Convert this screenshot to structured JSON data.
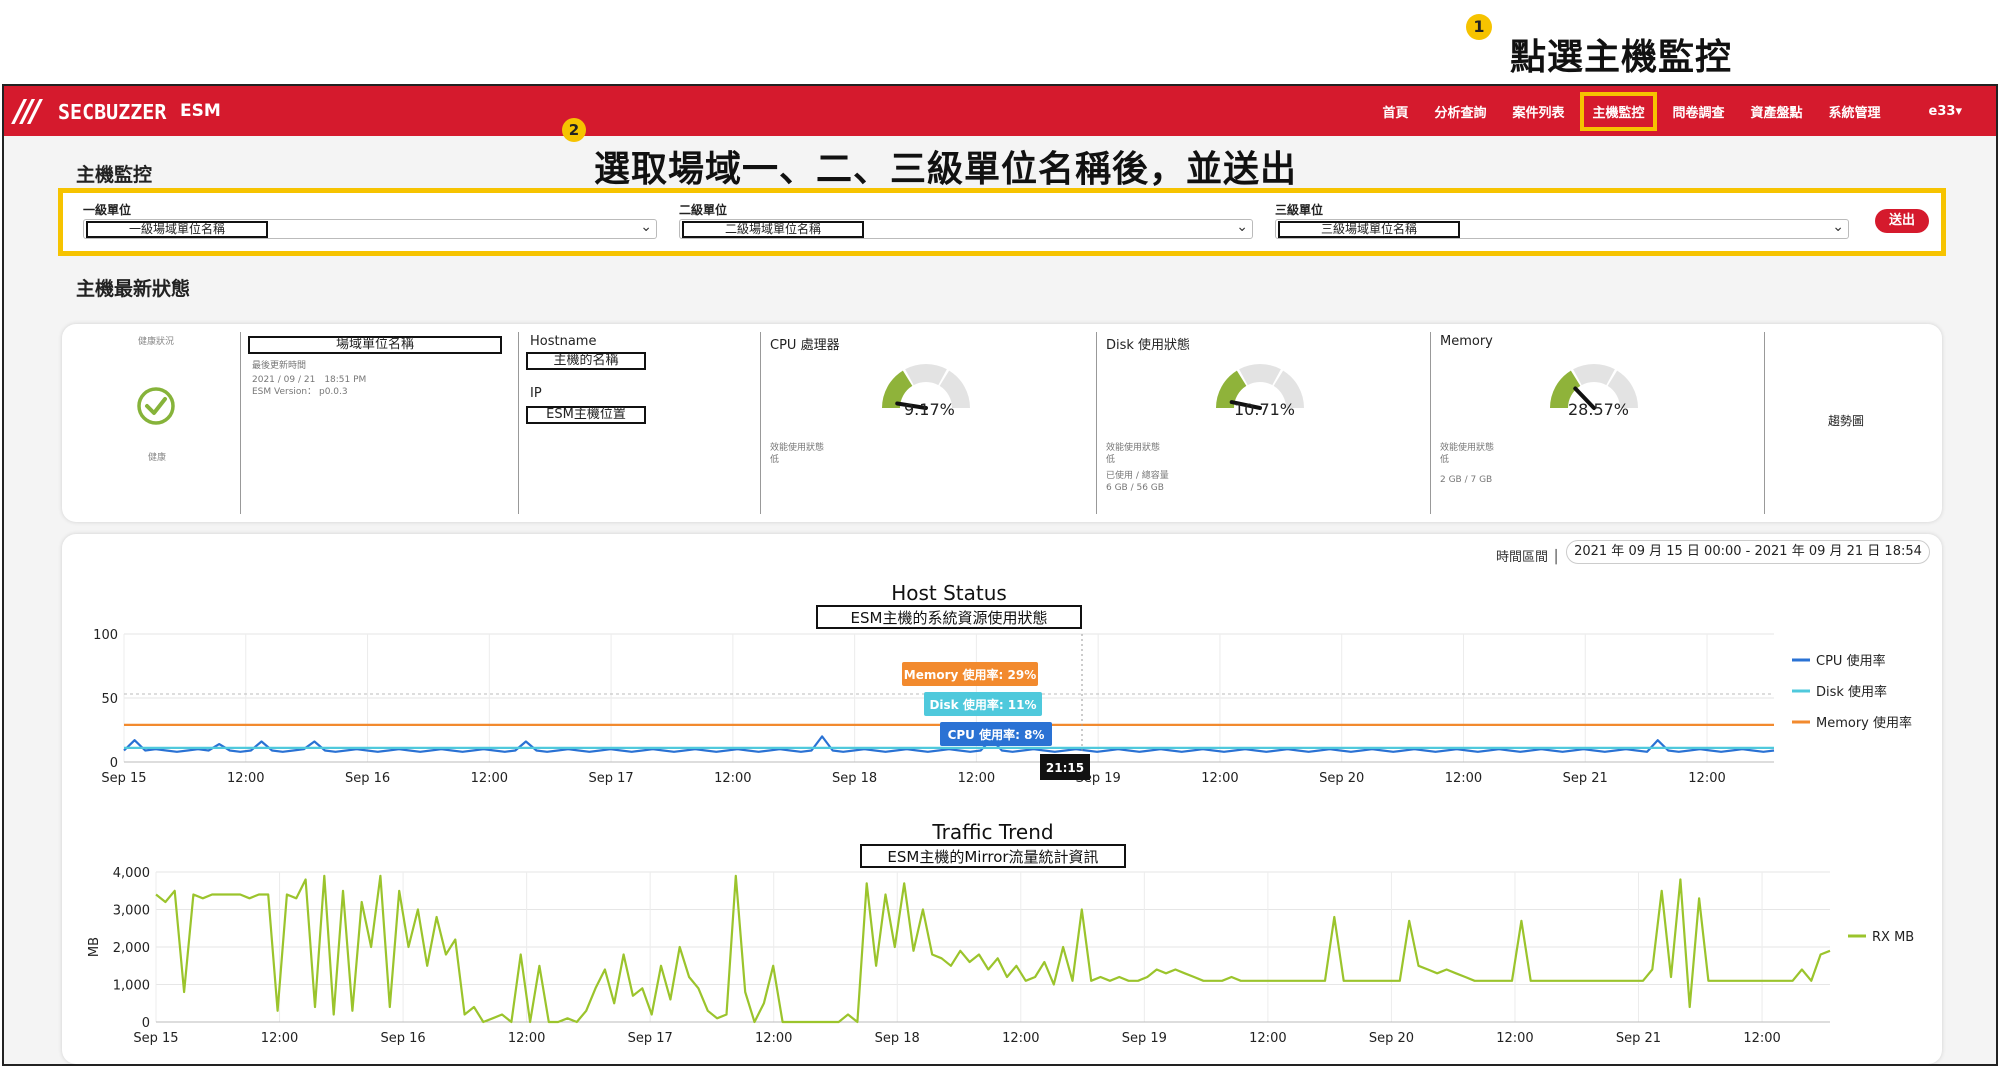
{
  "annotations": {
    "step1_number": "1",
    "step1_text": "點選主機監控",
    "step2_number": "2",
    "step2_text": "選取場域一、二、三級單位名稱後，並送出"
  },
  "topbar": {
    "brand": "SECBUZZER",
    "product": "ESM",
    "nav": [
      "首頁",
      "分析查詢",
      "案件列表",
      "主機監控",
      "問卷調查",
      "資產盤點",
      "系統管理"
    ],
    "active_nav": "主機監控",
    "user": "e33",
    "colors": {
      "bar": "#d51a2d",
      "highlight": "#f6c300"
    }
  },
  "page_title": "主機監控",
  "filters": [
    {
      "label": "一級單位",
      "value": "一級場域單位名稱"
    },
    {
      "label": "二級單位",
      "value": "二級場域單位名稱"
    },
    {
      "label": "三級單位",
      "value": "三級場域單位名稱"
    }
  ],
  "submit_label": "送出",
  "section_title": "主機最新狀態",
  "status": {
    "health_label": "健康狀況",
    "health_value": "健康",
    "unit_name": "場域單位名稱",
    "last_update_label": "最後更新時間",
    "last_update": "2021 / 09 / 21　18:51 PM",
    "version": "ESM Version： p0.0.3",
    "hostname_label": "Hostname",
    "hostname_value": "主機的名稱",
    "ip_label": "IP",
    "ip_value": "ESM主機位置",
    "cpu": {
      "title": "CPU 處理器",
      "percent": "9.17%",
      "value": 9.17,
      "state_label": "效能使用狀態",
      "state": "低"
    },
    "disk": {
      "title": "Disk 使用狀態",
      "percent": "10.71%",
      "value": 10.71,
      "state_label": "效能使用狀態",
      "state": "低",
      "used_label": "已使用 / 總容量",
      "used": "6 GB / 56 GB"
    },
    "memory": {
      "title": "Memory",
      "percent": "28.57%",
      "value": 28.57,
      "state_label": "效能使用狀態",
      "state": "低",
      "used": "2 GB / 7 GB"
    },
    "trend_label": "趨勢圖"
  },
  "time_range": {
    "label": "時間區間 │",
    "value": "2021 年 09 月 15 日 00:00 - 2021 年 09 月 21 日 18:54"
  },
  "chart_data": [
    {
      "type": "line",
      "title": "Host Status",
      "subtitle": "ESM主機的系統資源使用狀態",
      "x_ticks": [
        "Sep 15",
        "12:00",
        "Sep 16",
        "12:00",
        "Sep 17",
        "12:00",
        "Sep 18",
        "12:00",
        "Sep 19",
        "12:00",
        "Sep 20",
        "12:00",
        "Sep 21",
        "12:00"
      ],
      "y_ticks": [
        "0",
        "50",
        "100"
      ],
      "ylim": [
        0,
        100
      ],
      "legend_position": "right",
      "series": [
        {
          "name": "CPU 使用率",
          "color": "#2a72d4",
          "values": [
            9,
            17,
            9,
            10,
            9,
            8,
            9,
            10,
            9,
            14,
            9,
            8,
            9,
            16,
            9,
            8,
            9,
            10,
            16,
            9,
            8,
            9,
            10,
            9,
            8,
            9,
            10,
            9,
            8,
            9,
            10,
            9,
            8,
            9,
            10,
            9,
            8,
            9,
            16,
            9,
            8,
            9,
            10,
            9,
            8,
            9,
            10,
            9,
            8,
            9,
            10,
            9,
            8,
            9,
            10,
            9,
            8,
            9,
            10,
            9,
            8,
            9,
            10,
            9,
            8,
            9,
            20,
            9,
            8,
            9,
            10,
            9,
            8,
            9,
            10,
            9,
            8,
            9,
            10,
            9,
            8,
            9,
            18,
            9,
            8,
            9,
            10,
            9,
            8,
            9,
            10,
            9,
            8,
            9,
            10,
            9,
            8,
            9,
            10,
            9,
            8,
            9,
            10,
            9,
            8,
            9,
            10,
            9,
            8,
            9,
            10,
            9,
            8,
            9,
            10,
            9,
            8,
            9,
            10,
            9,
            8,
            9,
            10,
            9,
            8,
            9,
            10,
            9,
            8,
            9,
            10,
            9,
            8,
            9,
            10,
            9,
            8,
            9,
            10,
            9,
            8,
            9,
            10,
            9,
            8,
            17,
            9,
            8,
            9,
            10,
            9,
            8,
            9,
            10,
            9,
            8,
            9
          ]
        },
        {
          "name": "Disk 使用率",
          "color": "#4fc9dc",
          "values": [
            11,
            11,
            11,
            11,
            11,
            11,
            11,
            11,
            11,
            11,
            11,
            11,
            11,
            11,
            11,
            11,
            11,
            11,
            11,
            11,
            11,
            11,
            11,
            11,
            11,
            11,
            11,
            11,
            11,
            11
          ]
        },
        {
          "name": "Memory 使用率",
          "color": "#f28a2e",
          "values": [
            29,
            29,
            29,
            29,
            29,
            29,
            29,
            29,
            29,
            29,
            29,
            29,
            29,
            29,
            29,
            29,
            29,
            29,
            29,
            29,
            29,
            29,
            29,
            29,
            29,
            29,
            29,
            29,
            29,
            29
          ]
        }
      ],
      "tooltip": {
        "memory": "Memory 使用率: 29%",
        "disk": "Disk 使用率: 11%",
        "cpu": "CPU 使用率: 8%",
        "time": "21:15"
      }
    },
    {
      "type": "line",
      "title": "Traffic Trend",
      "subtitle": "ESM主機的Mirror流量統計資訊",
      "ylabel": "MB",
      "x_ticks": [
        "Sep 15",
        "12:00",
        "Sep 16",
        "12:00",
        "Sep 17",
        "12:00",
        "Sep 18",
        "12:00",
        "Sep 19",
        "12:00",
        "Sep 20",
        "12:00",
        "Sep 21",
        "12:00"
      ],
      "y_ticks": [
        "0",
        "1,000",
        "2,000",
        "3,000",
        "4,000"
      ],
      "ylim": [
        0,
        4000
      ],
      "legend_position": "right",
      "series": [
        {
          "name": "RX MB",
          "color": "#9bc42c",
          "values": [
            3400,
            3200,
            3500,
            800,
            3400,
            3300,
            3400,
            3400,
            3400,
            3400,
            3300,
            3400,
            3400,
            300,
            3400,
            3300,
            3800,
            400,
            3900,
            200,
            3500,
            300,
            3200,
            2000,
            3900,
            400,
            3500,
            2000,
            3000,
            1500,
            2800,
            1800,
            2200,
            200,
            400,
            0,
            100,
            200,
            0,
            1800,
            0,
            1500,
            0,
            0,
            100,
            0,
            300,
            900,
            1400,
            500,
            1800,
            700,
            900,
            200,
            1500,
            600,
            2000,
            1200,
            900,
            300,
            100,
            200,
            3900,
            800,
            0,
            500,
            1500,
            0,
            0,
            0,
            0,
            0,
            0,
            0,
            200,
            0,
            3700,
            1500,
            3400,
            2000,
            3700,
            1900,
            3000,
            1800,
            1700,
            1500,
            1900,
            1600,
            1800,
            1400,
            1700,
            1200,
            1500,
            1100,
            1200,
            1600,
            1000,
            2000,
            1100,
            3000,
            1100,
            1200,
            1100,
            1200,
            1100,
            1100,
            1200,
            1400,
            1300,
            1400,
            1300,
            1200,
            1100,
            1100,
            1100,
            1200,
            1100,
            1100,
            1100,
            1100,
            1100,
            1100,
            1100,
            1100,
            1100,
            1100,
            2800,
            1100,
            1100,
            1100,
            1100,
            1100,
            1100,
            1100,
            2700,
            1500,
            1400,
            1300,
            1400,
            1300,
            1200,
            1100,
            1100,
            1100,
            1100,
            1100,
            2700,
            1100,
            1100,
            1100,
            1100,
            1100,
            1100,
            1100,
            1100,
            1100,
            1100,
            1100,
            1100,
            1100,
            1400,
            3500,
            1200,
            3800,
            400,
            3300,
            1100,
            1100,
            1100,
            1100,
            1100,
            1100,
            1100,
            1100,
            1100,
            1100,
            1400,
            1100,
            1800,
            1900
          ]
        }
      ]
    }
  ]
}
